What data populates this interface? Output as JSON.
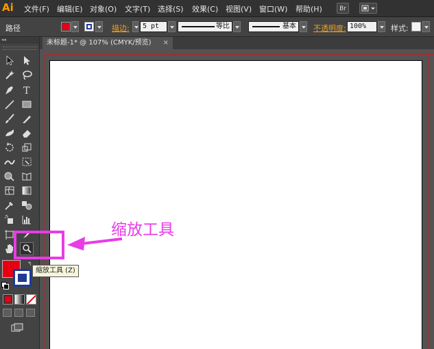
{
  "app": {
    "logo": "Ai"
  },
  "menubar": {
    "items": [
      "文件(F)",
      "编辑(E)",
      "对象(O)",
      "文字(T)",
      "选择(S)",
      "效果(C)",
      "视图(V)",
      "窗口(W)",
      "帮助(H)"
    ],
    "bridge_button": "Br"
  },
  "control": {
    "mode_label": "路径",
    "stroke_label": "描边:",
    "stroke_value": "5 pt",
    "profile_label": "等比",
    "brush_label": "基本",
    "opacity_label": "不透明度:",
    "opacity_value": "100%",
    "style_label": "样式:",
    "fill_color": "#e60012",
    "accent_color": "#ff9a00"
  },
  "document": {
    "tab_title": "未标题-1* @ 107% (CMYK/预览)",
    "tab_close": "×"
  },
  "tools": {
    "fill_color": "#e60012",
    "stroke_color": "#1f3a93",
    "panel_collapse": "◂◂",
    "icons": [
      "selection-tool",
      "direct-selection-tool",
      "magic-wand-tool",
      "lasso-tool",
      "pen-tool",
      "type-tool",
      "line-tool",
      "rectangle-tool",
      "paintbrush-tool",
      "pencil-tool",
      "blob-brush-tool",
      "eraser-tool",
      "rotate-tool",
      "scale-tool",
      "warp-tool",
      "free-transform-tool",
      "shape-builder-tool",
      "perspective-grid-tool",
      "mesh-tool",
      "gradient-tool",
      "eyedropper-tool",
      "blend-tool",
      "symbol-sprayer-tool",
      "column-graph-tool",
      "artboard-tool",
      "slice-tool",
      "hand-tool",
      "zoom-tool"
    ]
  },
  "annotation": {
    "callout_text": "缩放工具",
    "highlight_color": "#e83ce6"
  },
  "tooltip": {
    "text": "缩放工具 (Z)"
  }
}
